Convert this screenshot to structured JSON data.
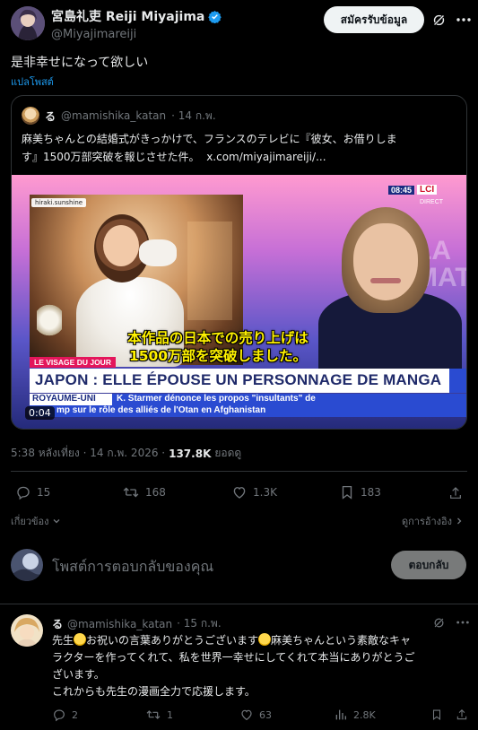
{
  "post": {
    "author_name": "宮島礼吏 Reiji Miyajima",
    "author_handle": "@Miyajimareiji",
    "subscribe_label": "สมัครรับข้อมูล",
    "text": "是非幸せになって欲しい",
    "translate_label": "แปลโพสต์",
    "timestamp": "5:38 หลังเที่ยง · 14 ก.พ. 2026 ·",
    "views_count": "137.8K",
    "views_label": "ยอดดู"
  },
  "quoted": {
    "author_name": "る",
    "author_handle": "@mamishika_katan",
    "date": "· 14 ก.พ.",
    "text_line1": "麻美ちゃんとの結婚式がきっかけで、フランスのテレビに『彼女、お借りしま",
    "text_line2_pre": "す』1500万部突破を報じさせた件。",
    "text_link": "x.com/miyajimareiji/...",
    "video": {
      "duration": "0:04",
      "clock": "08:45",
      "channel": "LCI",
      "channel_sub": "DIRECT",
      "source_tag": "hiraki.sunshine",
      "subtitle_line1": "本作品の日本での売り上げは",
      "subtitle_line2": "1500万部を突破しました。",
      "segment": "LE VISAGE DU JOUR",
      "headline": "JAPON : ELLE ÉPOUSE UN PERSONNAGE DE MANGA",
      "ticker_country": "ROYAUME-UNI",
      "ticker_line1": "K. Starmer dénonce les propos \"insultants\" de",
      "ticker_line2": "mp sur le rôle des alliés de l'Otan en Afghanistan",
      "studio_letters": "LA MAT"
    }
  },
  "actions": {
    "replies": "15",
    "reposts": "168",
    "likes": "1.3K",
    "bookmarks": "183"
  },
  "sort": {
    "relevant_label": "เกี่ยวข้อง",
    "quotes_label": "ดูการอ้างอิง"
  },
  "composer": {
    "placeholder": "โพสต์การตอบกลับของคุณ",
    "reply_button": "ตอบกลับ"
  },
  "reply": {
    "author_name": "る",
    "author_handle": "@mamishika_katan",
    "date": "· 15 ก.พ.",
    "line1_a": "先生",
    "line1_b": "お祝いの言葉ありがとうございます",
    "line1_c": "麻美ちゃんという素敵なキャ",
    "line2": "ラクターを作ってくれて、私を世界一幸せにしてくれて本当にありがとうご",
    "line3": "ざいます。",
    "line4": "これからも先生の漫画全力で応援します。",
    "replies": "2",
    "reposts": "1",
    "likes": "63",
    "views": "2.8K"
  }
}
